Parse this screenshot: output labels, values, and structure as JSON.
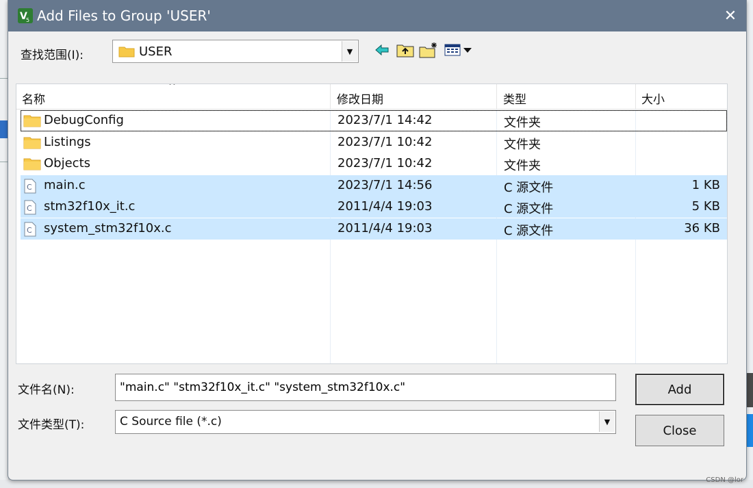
{
  "window": {
    "title": "Add Files to Group 'USER'",
    "titlebar_color": "#66788e",
    "close_glyph": "✕"
  },
  "look_in": {
    "label": "查找范围(I):",
    "value": "USER"
  },
  "toolbar": {
    "back_icon": "back-arrow-icon",
    "up_icon": "up-folder-icon",
    "new_folder_icon": "new-folder-icon",
    "view_menu_icon": "view-menu-icon"
  },
  "columns": {
    "name": "名称",
    "modified": "修改日期",
    "type": "类型",
    "size": "大小"
  },
  "files": [
    {
      "name": "DebugConfig",
      "modified": "2023/7/1 14:42",
      "type": "文件夹",
      "size": "",
      "icon": "folder-icon",
      "selected": false,
      "focused": true
    },
    {
      "name": "Listings",
      "modified": "2023/7/1 10:42",
      "type": "文件夹",
      "size": "",
      "icon": "folder-icon",
      "selected": false,
      "focused": false
    },
    {
      "name": "Objects",
      "modified": "2023/7/1 10:42",
      "type": "文件夹",
      "size": "",
      "icon": "folder-icon",
      "selected": false,
      "focused": false
    },
    {
      "name": "main.c",
      "modified": "2023/7/1 14:56",
      "type": "C 源文件",
      "size": "1 KB",
      "icon": "c-file-icon",
      "selected": true,
      "focused": false
    },
    {
      "name": "stm32f10x_it.c",
      "modified": "2011/4/4 19:03",
      "type": "C 源文件",
      "size": "5 KB",
      "icon": "c-file-icon",
      "selected": true,
      "focused": false
    },
    {
      "name": "system_stm32f10x.c",
      "modified": "2011/4/4 19:03",
      "type": "C 源文件",
      "size": "36 KB",
      "icon": "c-file-icon",
      "selected": true,
      "focused": false
    }
  ],
  "file_name": {
    "label": "文件名(N):",
    "value": "\"main.c\" \"stm32f10x_it.c\" \"system_stm32f10x.c\""
  },
  "file_type": {
    "label": "文件类型(T):",
    "value": "C Source file (*.c)"
  },
  "buttons": {
    "add": "Add",
    "close": "Close"
  },
  "watermark": "CSDN @lor",
  "colors": {
    "selection": "#cce8ff",
    "folder": "#f7c948"
  }
}
